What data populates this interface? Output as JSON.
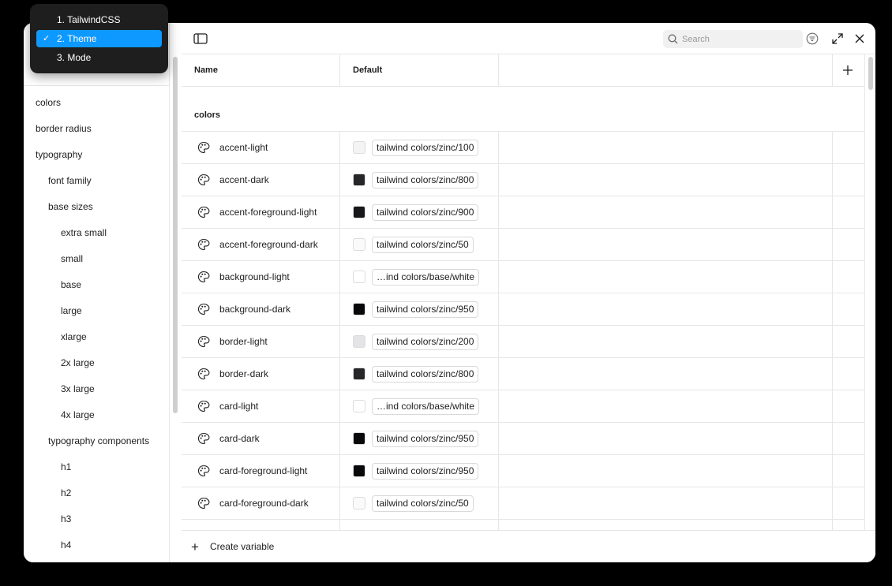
{
  "collection_menu": {
    "items": [
      {
        "label": "1. TailwindCSS",
        "selected": false
      },
      {
        "label": "2. Theme",
        "selected": true
      },
      {
        "label": "3. Mode",
        "selected": false
      }
    ],
    "check_glyph": "✓"
  },
  "sidebar": {
    "groups": [
      {
        "label": "colors",
        "level": 0
      },
      {
        "label": "border radius",
        "level": 0
      },
      {
        "label": "typography",
        "level": 0
      },
      {
        "label": "font family",
        "level": 1
      },
      {
        "label": "base sizes",
        "level": 1
      },
      {
        "label": "extra small",
        "level": 2
      },
      {
        "label": "small",
        "level": 2
      },
      {
        "label": "base",
        "level": 2
      },
      {
        "label": "large",
        "level": 2
      },
      {
        "label": "xlarge",
        "level": 2
      },
      {
        "label": "2x large",
        "level": 2
      },
      {
        "label": "3x large",
        "level": 2
      },
      {
        "label": "4x large",
        "level": 2
      },
      {
        "label": "typography components",
        "level": 1
      },
      {
        "label": "h1",
        "level": 2
      },
      {
        "label": "h2",
        "level": 2
      },
      {
        "label": "h3",
        "level": 2
      },
      {
        "label": "h4",
        "level": 2
      }
    ]
  },
  "toolbar": {
    "search_placeholder": "Search"
  },
  "table": {
    "columns": [
      "Name",
      "Default"
    ],
    "group_label": "colors",
    "rows": [
      {
        "name": "accent-light",
        "swatch": "#f4f4f5",
        "alias": "tailwind colors/zinc/100"
      },
      {
        "name": "accent-dark",
        "swatch": "#27272a",
        "alias": "tailwind colors/zinc/800"
      },
      {
        "name": "accent-foreground-light",
        "swatch": "#18181b",
        "alias": "tailwind colors/zinc/900"
      },
      {
        "name": "accent-foreground-dark",
        "swatch": "#fafafa",
        "alias": "tailwind colors/zinc/50"
      },
      {
        "name": "background-light",
        "swatch": "#ffffff",
        "alias": "…ind colors/base/white"
      },
      {
        "name": "background-dark",
        "swatch": "#09090b",
        "alias": "tailwind colors/zinc/950"
      },
      {
        "name": "border-light",
        "swatch": "#e4e4e7",
        "alias": "tailwind colors/zinc/200"
      },
      {
        "name": "border-dark",
        "swatch": "#27272a",
        "alias": "tailwind colors/zinc/800"
      },
      {
        "name": "card-light",
        "swatch": "#ffffff",
        "alias": "…ind colors/base/white"
      },
      {
        "name": "card-dark",
        "swatch": "#09090b",
        "alias": "tailwind colors/zinc/950"
      },
      {
        "name": "card-foreground-light",
        "swatch": "#09090b",
        "alias": "tailwind colors/zinc/950"
      },
      {
        "name": "card-foreground-dark",
        "swatch": "#fafafa",
        "alias": "tailwind colors/zinc/50"
      }
    ]
  },
  "footer": {
    "create_label": "Create variable"
  },
  "colors": {
    "accent": "#0d99ff",
    "menu_bg": "#1e1e1e",
    "border": "#e6e6e6"
  }
}
